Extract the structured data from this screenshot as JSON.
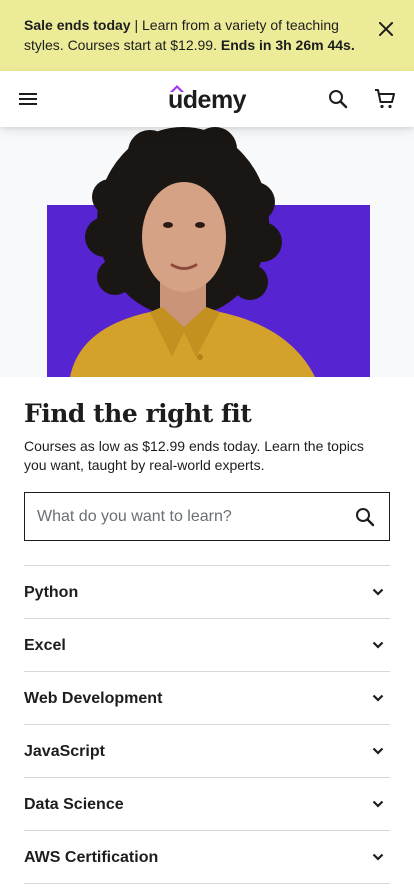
{
  "banner": {
    "bold_lead": "Sale ends today",
    "message": " | Learn from a variety of teaching styles. Courses start at $12.99. ",
    "countdown": "Ends in 3h 26m 44s.",
    "close_icon": "close-icon"
  },
  "header": {
    "logo_text": "udemy",
    "menu_icon": "hamburger-menu-icon",
    "search_icon": "search-icon",
    "cart_icon": "shopping-cart-icon"
  },
  "colors": {
    "banner_bg": "#eceb98",
    "brand_purple": "#5624d0",
    "text": "#1c1d1f",
    "border": "#d1d7dc"
  },
  "hero": {
    "title": "Find the right fit",
    "subtitle": "Courses as low as $12.99 ends today. Learn the topics you want, taught by real-world experts."
  },
  "search": {
    "placeholder": "What do you want to learn?",
    "value": ""
  },
  "topics": [
    {
      "label": "Python"
    },
    {
      "label": "Excel"
    },
    {
      "label": "Web Development"
    },
    {
      "label": "JavaScript"
    },
    {
      "label": "Data Science"
    },
    {
      "label": "AWS Certification"
    }
  ]
}
